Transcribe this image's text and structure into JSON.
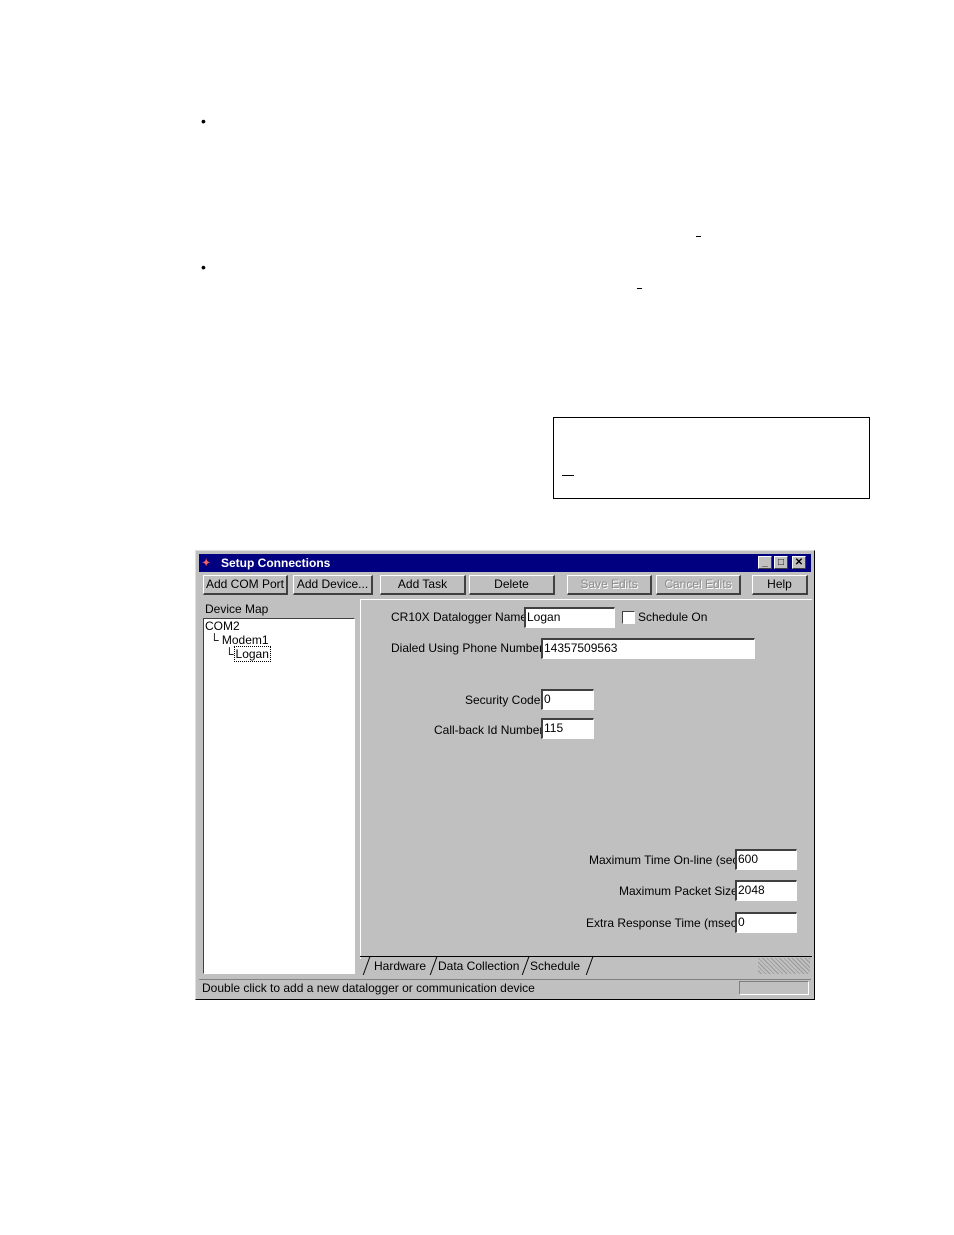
{
  "doc": {
    "bullet_1": "•",
    "bullet_2": "•"
  },
  "window": {
    "title": "Setup Connections",
    "controls": {
      "minimize": "_",
      "maximize": "□",
      "close": "✕"
    },
    "toolbar": {
      "add_com_port": "Add COM Port",
      "add_device": "Add Device...",
      "add_task": "Add Task",
      "delete": "Delete",
      "save_edits": "Save Edits",
      "cancel_edits": "Cancel Edits",
      "help": "Help"
    },
    "device_map": {
      "heading": "Device Map",
      "items": [
        {
          "label": "COM2",
          "prefix": ""
        },
        {
          "label": "Modem1",
          "prefix": "└ "
        },
        {
          "label": "Logan",
          "prefix": "└"
        }
      ]
    },
    "form": {
      "datalogger_name_label": "CR10X Datalogger Name:",
      "datalogger_name_value": "Logan",
      "schedule_on_label": "Schedule On",
      "schedule_on_checked": false,
      "phone_label": "Dialed Using Phone Number:",
      "phone_value": "14357509563",
      "security_code_label": "Security Code:",
      "security_code_value": "0",
      "callback_label": "Call-back Id Number:",
      "callback_value": "115",
      "max_time_label": "Maximum Time On-line (sec):",
      "max_time_value": "600",
      "max_packet_label": "Maximum Packet Size:",
      "max_packet_value": "2048",
      "extra_response_label": "Extra Response Time (msec):",
      "extra_response_value": "0"
    },
    "tabs": [
      "Hardware",
      "Data Collection",
      "Schedule"
    ],
    "active_tab": "Hardware",
    "status_text": "Double click to add a new datalogger or communication device"
  }
}
